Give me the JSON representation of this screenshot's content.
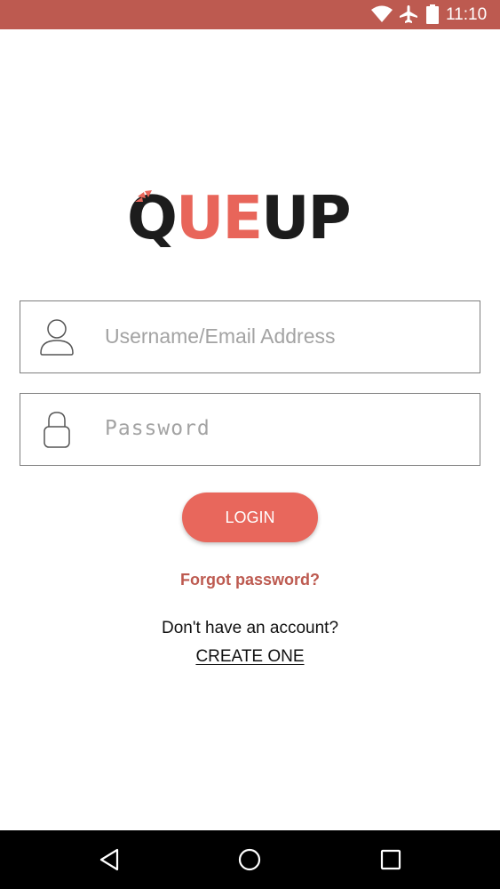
{
  "status_bar": {
    "time": "11:10",
    "icons": [
      "wifi-icon",
      "airplane-mode-icon",
      "battery-icon"
    ],
    "background": "#bd5a50"
  },
  "logo": {
    "part1": "Q",
    "part2": "UE",
    "part3": "UP",
    "dark_color": "#1c1c1c",
    "accent_color": "#e8655a"
  },
  "form": {
    "username": {
      "placeholder": "Username/Email Address",
      "icon": "user-icon"
    },
    "password": {
      "placeholder": "Password",
      "icon": "lock-icon"
    },
    "login_label": "LOGIN",
    "login_color": "#e8675c",
    "forgot_label": "Forgot password?",
    "no_account_text": "Don't have an account?",
    "create_label": "CREATE ONE"
  },
  "nav_bar": {
    "buttons": [
      "back-icon",
      "home-icon",
      "recents-icon"
    ]
  }
}
